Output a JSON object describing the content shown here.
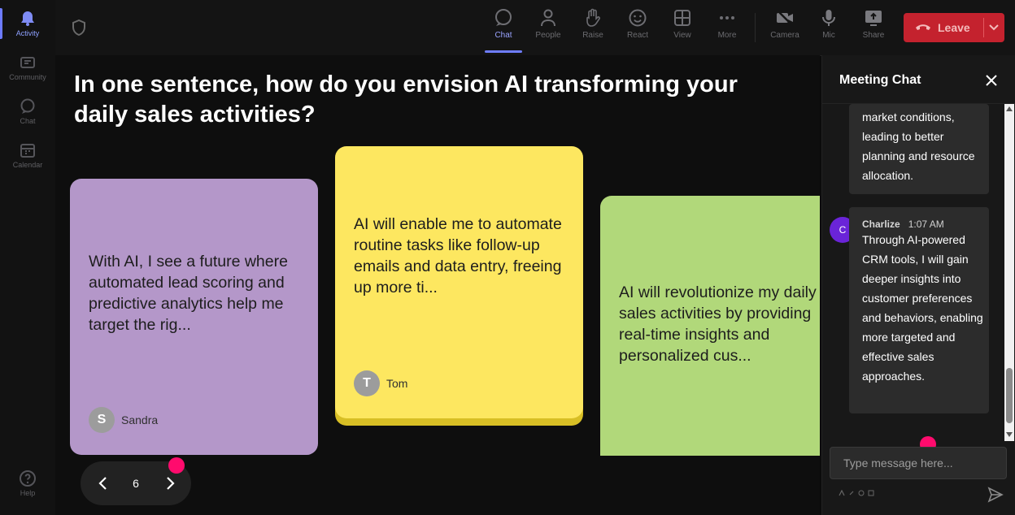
{
  "rail": {
    "items": [
      {
        "label": "Activity"
      },
      {
        "label": "Community"
      },
      {
        "label": "Chat"
      },
      {
        "label": "Calendar"
      },
      {
        "label": "Help"
      }
    ]
  },
  "toolbar": {
    "chat": "Chat",
    "people": "People",
    "raise": "Raise",
    "react": "React",
    "view": "View",
    "more": "More",
    "camera": "Camera",
    "mic": "Mic",
    "share": "Share",
    "leave": "Leave"
  },
  "stage": {
    "question": "In one sentence, how do you envision AI transforming your daily sales activities?",
    "cards": [
      {
        "text": "With AI, I see a future where automated lead scoring and predictive analytics help me target the rig...",
        "author": "Sandra",
        "initial": "S",
        "color": "#b497c9"
      },
      {
        "text": "AI will enable me to automate routine tasks like follow-up emails and data entry, freeing up more ti...",
        "author": "Tom",
        "initial": "T",
        "color": "#fde760"
      },
      {
        "text": "AI will revolutionize my daily sales activities by providing real-time insights and personalized cus...",
        "author": "",
        "initial": "",
        "color": "#b1d87a"
      }
    ],
    "page": "6"
  },
  "chat": {
    "title": "Meeting Chat",
    "messages": [
      {
        "text": "market conditions, leading to better planning and resource allocation."
      },
      {
        "sender": "Charlize",
        "time": "1:07 AM",
        "initial": "C",
        "text": "Through AI-powered CRM tools, I will gain deeper insights into customer preferences and behaviors, enabling more targeted and effective sales approaches."
      }
    ],
    "input_placeholder": "Type message here..."
  },
  "colors": {
    "accent": "#6e7dff",
    "leave": "#c4222e",
    "pointer": "#ff0b6d"
  }
}
